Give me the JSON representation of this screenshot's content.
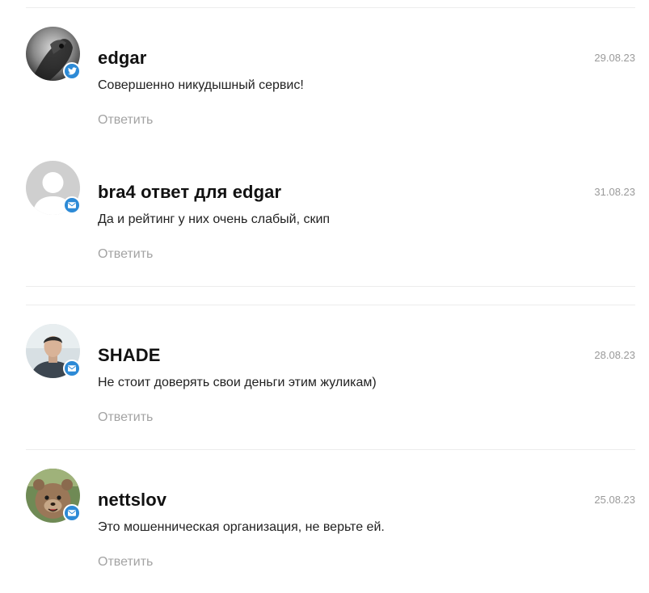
{
  "comments": [
    {
      "author": "edgar",
      "date": "29.08.23",
      "text": "Совершенно никудышный сервис!",
      "reply_label": "Ответить",
      "avatar_icon": "dark-photo-avatar",
      "badge_icon": "twitter-icon"
    },
    {
      "author": "bra4 ответ для edgar",
      "date": "31.08.23",
      "text": "Да и рейтинг у них очень слабый, скип",
      "reply_label": "Ответить",
      "avatar_icon": "default-user-avatar",
      "badge_icon": "mail-icon"
    },
    {
      "author": "SHADE",
      "date": "28.08.23",
      "text": "Не стоит доверять свои деньги этим жуликам)",
      "reply_label": "Ответить",
      "avatar_icon": "person-photo-avatar",
      "badge_icon": "mail-icon"
    },
    {
      "author": "nettslov",
      "date": "25.08.23",
      "text": "Это мошенническая организация, не верьте ей.",
      "reply_label": "Ответить",
      "avatar_icon": "animal-photo-avatar",
      "badge_icon": "mail-icon"
    }
  ],
  "colors": {
    "badge": "#2d8ad6",
    "reply_link": "#a3a3a3",
    "date": "#9a9a9a",
    "divider": "#ececec"
  }
}
